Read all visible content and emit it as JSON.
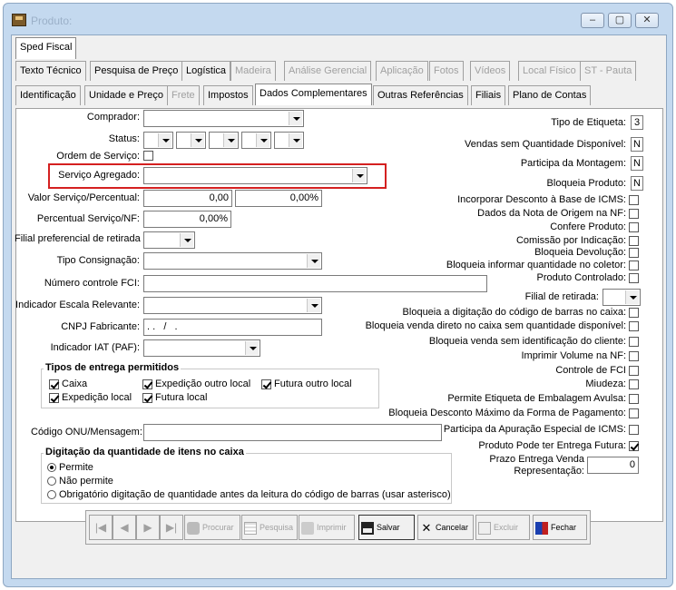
{
  "window": {
    "title": "Produto:",
    "min": "–",
    "max": "▢",
    "close": "✕"
  },
  "tabs_row1": [
    {
      "label": "Sped Fiscal"
    }
  ],
  "tabs_row2": [
    {
      "label": "Texto Técnico"
    },
    {
      "label": "Pesquisa de Preço"
    },
    {
      "label": "Logística"
    },
    {
      "label": "Madeira"
    },
    {
      "label": "Análise Gerencial"
    },
    {
      "label": "Aplicação"
    },
    {
      "label": "Fotos"
    },
    {
      "label": "Vídeos"
    },
    {
      "label": "Local Físico"
    },
    {
      "label": "ST - Pauta"
    }
  ],
  "tabs_row3": [
    {
      "label": "Identificação"
    },
    {
      "label": "Unidade e Preço"
    },
    {
      "label": "Frete"
    },
    {
      "label": "Impostos"
    },
    {
      "label": "Dados Complementares"
    },
    {
      "label": "Outras Referências"
    },
    {
      "label": "Filiais"
    },
    {
      "label": "Plano de Contas"
    }
  ],
  "left": {
    "comprador": "Comprador:",
    "status": "Status:",
    "ordem_servico": "Ordem de Serviço:",
    "servico_agregado": "Serviço Agregado:",
    "valor_servico": "Valor Serviço/Percentual:",
    "valor_servico_v1": "0,00",
    "valor_servico_v2": "0,00%",
    "percentual_servico": "Percentual Serviço/NF:",
    "percentual_servico_v": "0,00%",
    "filial_pref": "Filial preferencial de retirada",
    "tipo_consig": "Tipo Consignação:",
    "fci": "Número controle FCI:",
    "escala": "Indicador Escala Relevante:",
    "cnpj": "CNPJ Fabricante:",
    "cnpj_v": ". .   /   .",
    "iat": "Indicador IAT (PAF):",
    "onu": "Código ONU/Mensagem:"
  },
  "entrega": {
    "title": "Tipos de entrega permitidos",
    "items": [
      {
        "label": "Caixa",
        "checked": true
      },
      {
        "label": "Expedição outro local",
        "checked": true
      },
      {
        "label": "Futura outro local",
        "checked": true
      },
      {
        "label": "Expedição local",
        "checked": true
      },
      {
        "label": "Futura local",
        "checked": true
      }
    ]
  },
  "digitacao": {
    "title": "Digitação da quantidade de itens no caixa",
    "options": [
      {
        "label": "Permite",
        "selected": true
      },
      {
        "label": "Não permite",
        "selected": false
      },
      {
        "label": "Obrigatório digitação de quantidade antes da leitura do código de barras (usar asterisco)",
        "selected": false
      }
    ]
  },
  "right": {
    "tipo_etiqueta": "Tipo de Etiqueta:",
    "tipo_etiqueta_v": "3",
    "vendas_sem_qtd": "Vendas sem Quantidade Disponível:",
    "vendas_sem_qtd_v": "N",
    "participa_montagem": "Participa da Montagem:",
    "participa_montagem_v": "N",
    "bloqueia_produto": "Bloqueia Produto:",
    "bloqueia_produto_v": "N",
    "checks": [
      {
        "label": "Incorporar Desconto à Base de ICMS:",
        "checked": false
      },
      {
        "label": "Dados da Nota de Origem na NF:",
        "checked": false
      },
      {
        "label": "Confere Produto:",
        "checked": false
      },
      {
        "label": "Comissão por Indicação:",
        "checked": false
      },
      {
        "label": "Bloqueia Devolução:",
        "checked": false
      },
      {
        "label": "Bloqueia informar quantidade no coletor:",
        "checked": false
      },
      {
        "label": "Produto Controlado:",
        "checked": false
      }
    ],
    "filial_retirada": "Filial de retirada:",
    "checks2": [
      {
        "label": "Bloqueia a digitação do código de barras no caixa:",
        "checked": false
      },
      {
        "label": "Bloqueia venda direto no caixa sem quantidade disponível:",
        "checked": false
      },
      {
        "label": "Bloqueia venda sem identificação do cliente:",
        "checked": false
      },
      {
        "label": "Imprimir Volume na NF:",
        "checked": false
      },
      {
        "label": "Controle de FCI",
        "checked": false
      },
      {
        "label": "Miudeza:",
        "checked": false
      },
      {
        "label": "Permite Etiqueta de Embalagem Avulsa:",
        "checked": false
      },
      {
        "label": "Bloqueia Desconto Máximo da Forma de Pagamento:",
        "checked": false
      },
      {
        "label": "Participa da Apuração Especial de ICMS:",
        "checked": false
      },
      {
        "label": "Produto Pode ter Entrega Futura:",
        "checked": true
      }
    ],
    "prazo_1": "Prazo Entrega Venda",
    "prazo_2": "Representação:",
    "prazo_v": "0"
  },
  "toolbar": {
    "procurar": "Procurar",
    "pesquisa": "Pesquisa",
    "imprimir": "Imprimir",
    "salvar": "Salvar",
    "cancelar": "Cancelar",
    "excluir": "Excluir",
    "fechar": "Fechar"
  }
}
